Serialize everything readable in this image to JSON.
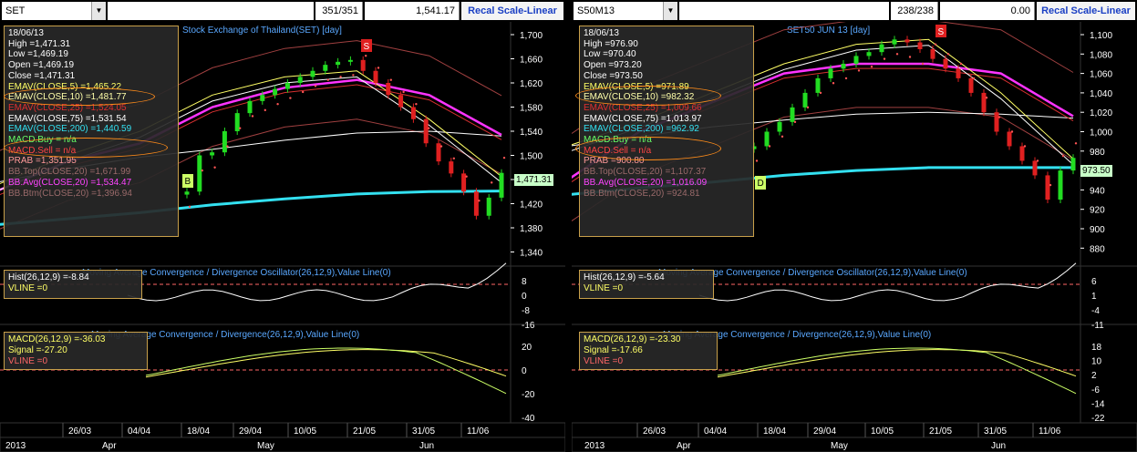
{
  "colors": {
    "up": "#22dd22",
    "down": "#e02020",
    "ema5": "#ffff66",
    "ema10": "#ffffff",
    "ema25": "#d83030",
    "ema75": "#ffffff",
    "ema200": "#33e0f0",
    "bbavg": "#ff33ff",
    "bbband": "#a04040",
    "prab": "#ff5555",
    "macd": "#ccff66",
    "signal": "#ffff66",
    "vline": "#ff6666",
    "hist": "#ffffff",
    "title": "#5aa8ff"
  },
  "panels": [
    {
      "id": "set",
      "symbol": "SET",
      "count": "351/351",
      "last": "1,541.17",
      "recal_label": "Recal Scale-Linear",
      "chart_title": "Stock Exchange of Thailand(SET) [day]",
      "sell_marker": "S",
      "buy_marker": "B",
      "price_label": "1,471.31",
      "legend": {
        "date": "18/06/13",
        "high": "High  =1,471.31",
        "low": "Low   =1,469.19",
        "open": "Open  =1,469.19",
        "close": "Close  =1,471.31",
        "ema5": "EMAV(CLOSE,5)   =1,465.22",
        "ema10": "EMAV(CLOSE,10)   =1,481.77",
        "ema25": "EMAV(CLOSE,25)   =1,524.05",
        "ema75": "EMAV(CLOSE,75)   =1,531.54",
        "ema200": "EMAV(CLOSE,200)  =1,440.59",
        "macdbuy": "MACD.Buy    = n/a",
        "macdsell": "MACD.Sell   = n/a",
        "prab": "PRAB   =1,351.95",
        "bbtop": "BB.Top(CLOSE,20)   =1,671.99",
        "bbavg": "BB.Avg(CLOSE,20)   =1,534.47",
        "bbbtm": "BB.Btm(CLOSE,20)   =1,396.94"
      },
      "hist_legend": {
        "hist": "Hist(26,12,9)   =-8.84",
        "vline": "VLINE   =0"
      },
      "hist_title": "Moving Average Convergence / Divergence Oscillator(26,12,9),Value Line(0)",
      "macd_legend": {
        "macd": "MACD(26,12,9)   =-36.03",
        "signal": "Signal   =-27.20",
        "vline": "VLINE   =0"
      },
      "macd_title": "Moving Average Convergence / Divergence(26,12,9),Value Line(0)",
      "y_ticks": [
        "1,700",
        "1,660",
        "1,620",
        "1,580",
        "1,540",
        "1,500",
        "1,460",
        "1,420",
        "1,380",
        "1,340"
      ],
      "hist_ticks": [
        "8",
        "0",
        "-8",
        "-16"
      ],
      "macd_ticks": [
        "20",
        "0",
        "-20",
        "-40"
      ],
      "x_ticks": [
        "26/03",
        "04/04",
        "18/04",
        "29/04",
        "10/05",
        "21/05",
        "31/05",
        "11/06"
      ],
      "month_ticks": [
        "2013",
        "Apr",
        "May",
        "Jun"
      ]
    },
    {
      "id": "s50",
      "symbol": "S50M13",
      "count": "238/238",
      "last": "0.00",
      "recal_label": "Recal Scale-Linear",
      "chart_title": "SET50 JUN 13  [day]",
      "sell_marker": "S",
      "buy_marker": "D",
      "price_label": "973.50",
      "legend": {
        "date": "18/06/13",
        "high": "High  =976.90",
        "low": "Low   =970.40",
        "open": "Open  =973.20",
        "close": "Close  =973.50",
        "ema5": "EMAV(CLOSE,5)   =971.89",
        "ema10": "EMAV(CLOSE,10)   =982.32",
        "ema25": "EMAV(CLOSE,25)   =1,009.66",
        "ema75": "EMAV(CLOSE,75)   =1,013.97",
        "ema200": "EMAV(CLOSE,200)   =962.92",
        "macdbuy": "MACD.Buy   = n/a",
        "macdsell": "MACD.Sell   = n/a",
        "prab": "PRAB   =900.80",
        "bbtop": "BB.Top(CLOSE,20)   =1,107.37",
        "bbavg": "BB.Avg(CLOSE,20)   =1,016.09",
        "bbbtm": "BB.Btm(CLOSE,20)   =924.81"
      },
      "hist_legend": {
        "hist": "Hist(26,12,9)   =-5.64",
        "vline": "VLINE   =0"
      },
      "hist_title": "Moving Average Convergence / Divergence Oscillator(26,12,9),Value Line(0)",
      "macd_legend": {
        "macd": "MACD(26,12,9)   =-23.30",
        "signal": "Signal   =-17.66",
        "vline": "VLINE   =0"
      },
      "macd_title": "Moving Average Convergence / Divergence(26,12,9),Value Line(0)",
      "y_ticks": [
        "1,100",
        "1,080",
        "1,060",
        "1,040",
        "1,020",
        "1,000",
        "980",
        "960",
        "940",
        "920",
        "900",
        "880"
      ],
      "hist_ticks": [
        "6",
        "1",
        "-4",
        "-11"
      ],
      "macd_ticks": [
        "18",
        "10",
        "2",
        "-6",
        "-14",
        "-22"
      ],
      "x_ticks": [
        "26/03",
        "04/04",
        "18/04",
        "29/04",
        "10/05",
        "21/05",
        "31/05",
        "11/06"
      ],
      "month_ticks": [
        "2013",
        "Apr",
        "May",
        "Jun"
      ]
    }
  ],
  "chart_data": [
    {
      "type": "line",
      "title": "Stock Exchange of Thailand(SET) [day]",
      "x": [
        "26/03",
        "04/04",
        "18/04",
        "29/04",
        "10/05",
        "21/05",
        "31/05",
        "11/06"
      ],
      "ylim": [
        1340,
        1710
      ],
      "series": [
        {
          "name": "EMAV(CLOSE,200)",
          "values": [
            1385,
            1395,
            1405,
            1418,
            1428,
            1436,
            1440,
            1441
          ]
        },
        {
          "name": "BB.Avg(CLOSE,20)",
          "values": [
            1440,
            1490,
            1520,
            1580,
            1612,
            1625,
            1600,
            1534
          ]
        },
        {
          "name": "EMAV(CLOSE,75)",
          "values": [
            1455,
            1478,
            1497,
            1510,
            1525,
            1537,
            1540,
            1532
          ]
        },
        {
          "name": "EMAV(CLOSE,5)",
          "values": [
            1450,
            1500,
            1540,
            1600,
            1630,
            1640,
            1560,
            1465
          ]
        }
      ],
      "candles_close": [
        1440,
        1500,
        1505,
        1540,
        1570,
        1590,
        1600,
        1610,
        1620,
        1630,
        1640,
        1650,
        1655,
        1658,
        1640,
        1620,
        1600,
        1580,
        1560,
        1520,
        1490,
        1470,
        1440,
        1400,
        1430,
        1471
      ]
    },
    {
      "type": "line",
      "title": "SET50 JUN 13  [day]",
      "x": [
        "26/03",
        "04/04",
        "18/04",
        "29/04",
        "10/05",
        "21/05",
        "31/05",
        "11/06"
      ],
      "ylim": [
        870,
        1110
      ],
      "series": [
        {
          "name": "EMAV(CLOSE,200)",
          "values": [
            935,
            942,
            948,
            955,
            960,
            963,
            963,
            963
          ]
        },
        {
          "name": "BB.Avg(CLOSE,20)",
          "values": [
            950,
            1000,
            1030,
            1060,
            1070,
            1070,
            1060,
            1016
          ]
        },
        {
          "name": "EMAV(CLOSE,75)",
          "values": [
            985,
            995,
            1005,
            1012,
            1018,
            1020,
            1018,
            1014
          ]
        },
        {
          "name": "EMAV(CLOSE,5)",
          "values": [
            985,
            1010,
            1040,
            1070,
            1090,
            1095,
            1040,
            972
          ]
        }
      ],
      "candles_close": [
        985,
        1000,
        1010,
        1025,
        1040,
        1055,
        1065,
        1070,
        1078,
        1082,
        1090,
        1095,
        1092,
        1085,
        1075,
        1065,
        1055,
        1040,
        1020,
        1000,
        985,
        970,
        955,
        930,
        960,
        973
      ]
    }
  ]
}
